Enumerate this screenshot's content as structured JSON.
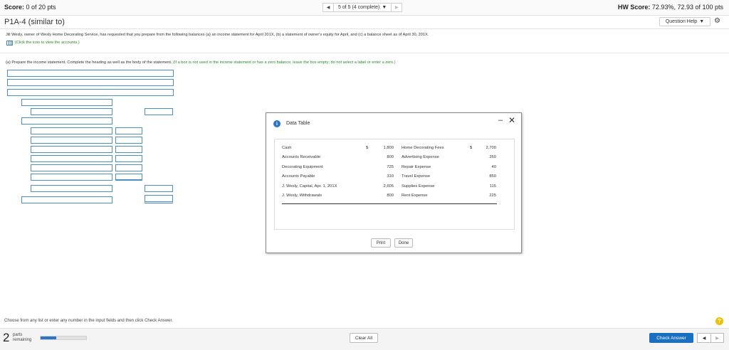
{
  "topbar": {
    "score_label": "Score:",
    "score_value": "0 of 20 pts",
    "nav_status": "5 of 5 (4 complete)",
    "hw_score_label": "HW Score:",
    "hw_score_value": "72.93%, 72.93 of 100 pts"
  },
  "problem": {
    "title": "P1A-4 (similar to)",
    "question_help": "Question Help",
    "text": "Jill Wesly, owner of Wesly Home Decorating Service, has requested that you prepare from the following balances (a) an income statement for April 201X, (b) a statement of owner's equity for April, and (c) a balance sheet as of April 30, 201X.",
    "click_hint": "(Click the icon to view the accounts.)",
    "part_a": "(a) Prepare the income statement. Complete the heading as well as the body of the statement.",
    "part_a_note": "(If a box is not used in the income statement or has a zero balance, leave the box empty; do not select a label or enter a zero.)"
  },
  "modal": {
    "title": "Data Table",
    "rows": [
      {
        "left_name": "Cash",
        "left_sym": "$",
        "left_val": "1,800",
        "right_name": "Home Decorating Fees",
        "right_sym": "$",
        "right_val": "2,700"
      },
      {
        "left_name": "Accounts Receivable",
        "left_sym": "",
        "left_val": "800",
        "right_name": "Advertising Expense",
        "right_sym": "",
        "right_val": "260"
      },
      {
        "left_name": "Decorating Equipment",
        "left_sym": "",
        "left_val": "725",
        "right_name": "Repair Expense",
        "right_sym": "",
        "right_val": "40"
      },
      {
        "left_name": "Accounts Payable",
        "left_sym": "",
        "left_val": "310",
        "right_name": "Travel Expense",
        "right_sym": "",
        "right_val": "850"
      },
      {
        "left_name": "J. Wesly, Capital, Apr. 1, 201X",
        "left_sym": "",
        "left_val": "2,605",
        "right_name": "Supplies Expense",
        "right_sym": "",
        "right_val": "115"
      },
      {
        "left_name": "J. Wesly, Withdrawals",
        "left_sym": "",
        "left_val": "800",
        "right_name": "Rent Expense",
        "right_sym": "",
        "right_val": "225"
      }
    ],
    "print_label": "Print",
    "done_label": "Done"
  },
  "footer": {
    "hint": "Choose from any list or enter any number in the input fields and then click Check Answer.",
    "parts_count": "2",
    "parts_label_1": "parts",
    "parts_label_2": "remaining",
    "progress": 0.35,
    "clear_all": "Clear All",
    "check_answer": "Check Answer"
  },
  "colors": {
    "accent": "#2d74c4",
    "input_border": "#4a90c8",
    "hint_green": "#2a8a2a",
    "help_yellow": "#f0c000"
  }
}
